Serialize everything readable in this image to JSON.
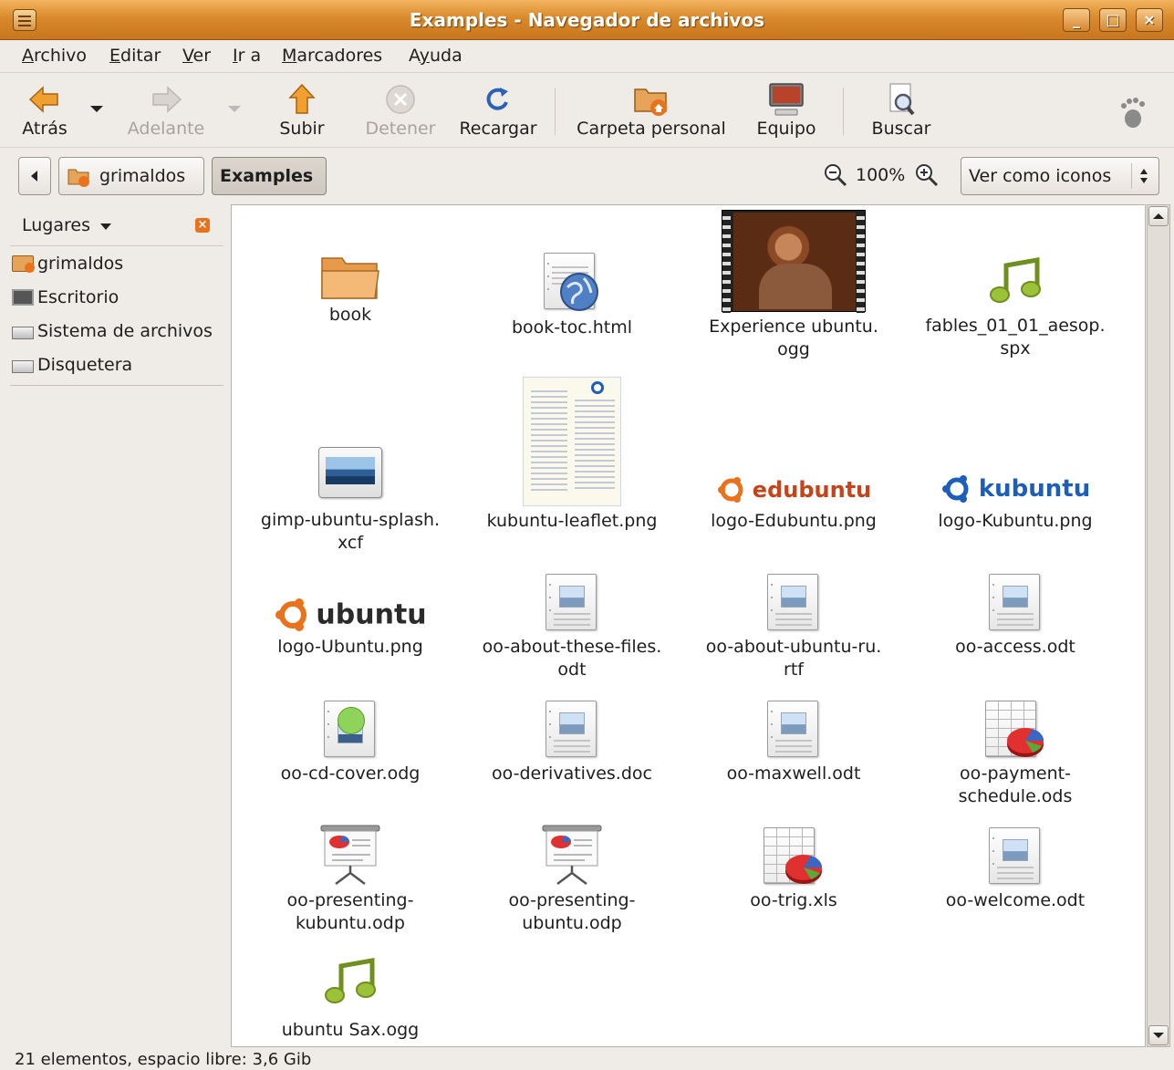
{
  "window": {
    "title": "Examples - Navegador de archivos",
    "buttons": [
      "_",
      "□",
      "×"
    ]
  },
  "menu": [
    {
      "label": "Archivo",
      "u": "A",
      "rest": "rchivo"
    },
    {
      "label": "Editar",
      "u": "E",
      "rest": "ditar"
    },
    {
      "label": "Ver",
      "u": "V",
      "rest": "er"
    },
    {
      "label": "Ir a",
      "u": "I",
      "rest": "r a"
    },
    {
      "label": "Marcadores",
      "u": "M",
      "rest": "arcadores"
    },
    {
      "label": "Ayuda",
      "pre": "A",
      "u": "y",
      "rest": "uda"
    }
  ],
  "toolbar": {
    "back": "Atrás",
    "forward": "Adelante",
    "up": "Subir",
    "stop": "Detener",
    "reload": "Recargar",
    "home": "Carpeta personal",
    "computer": "Equipo",
    "search": "Buscar"
  },
  "location": {
    "crumbs": [
      "grimaldos",
      "Examples"
    ],
    "zoom": "100%",
    "view_mode": "Ver como iconos"
  },
  "sidebar": {
    "title": "Lugares",
    "items": [
      "grimaldos",
      "Escritorio",
      "Sistema de archivos",
      "Disquetera"
    ]
  },
  "files": [
    {
      "line1": "book",
      "line2": "",
      "icon": "folder-icon"
    },
    {
      "line1": "book-toc.html",
      "line2": "",
      "icon": "html-document-icon"
    },
    {
      "line1": "Experience ubuntu.",
      "line2": "ogg",
      "icon": "video-thumbnail"
    },
    {
      "line1": "fables_01_01_aesop.",
      "line2": "spx",
      "icon": "music-note-icon"
    },
    {
      "line1": "gimp-ubuntu-splash.",
      "line2": "xcf",
      "icon": "image-icon"
    },
    {
      "line1": "kubuntu-leaflet.png",
      "line2": "",
      "icon": "leaflet-thumbnail"
    },
    {
      "line1": "logo-Edubuntu.png",
      "line2": "",
      "icon": "edubuntu-logo",
      "logo_text": "edubuntu"
    },
    {
      "line1": "logo-Kubuntu.png",
      "line2": "",
      "icon": "kubuntu-logo",
      "logo_text": "kubuntu"
    },
    {
      "line1": "logo-Ubuntu.png",
      "line2": "",
      "icon": "ubuntu-logo",
      "logo_text": "ubuntu"
    },
    {
      "line1": "oo-about-these-files.",
      "line2": "odt",
      "icon": "text-document-icon"
    },
    {
      "line1": "oo-about-ubuntu-ru.",
      "line2": "rtf",
      "icon": "text-document-icon"
    },
    {
      "line1": "oo-access.odt",
      "line2": "",
      "icon": "text-document-icon"
    },
    {
      "line1": "oo-cd-cover.odg",
      "line2": "",
      "icon": "drawing-document-icon"
    },
    {
      "line1": "oo-derivatives.doc",
      "line2": "",
      "icon": "text-document-icon"
    },
    {
      "line1": "oo-maxwell.odt",
      "line2": "",
      "icon": "text-document-icon"
    },
    {
      "line1": "oo-payment-",
      "line2": "schedule.ods",
      "icon": "spreadsheet-icon"
    },
    {
      "line1": "oo-presenting-",
      "line2": "kubuntu.odp",
      "icon": "presentation-icon"
    },
    {
      "line1": "oo-presenting-",
      "line2": "ubuntu.odp",
      "icon": "presentation-icon"
    },
    {
      "line1": "oo-trig.xls",
      "line2": "",
      "icon": "spreadsheet-icon"
    },
    {
      "line1": "oo-welcome.odt",
      "line2": "",
      "icon": "text-document-icon"
    },
    {
      "line1": "ubuntu Sax.ogg",
      "line2": "",
      "icon": "music-note-icon"
    }
  ],
  "status": "21 elementos, espacio libre: 3,6 Gib",
  "colors": {
    "titlebar": "#d98a2c",
    "accent_orange": "#e8731c",
    "kubuntu_blue": "#1d5fb8"
  }
}
